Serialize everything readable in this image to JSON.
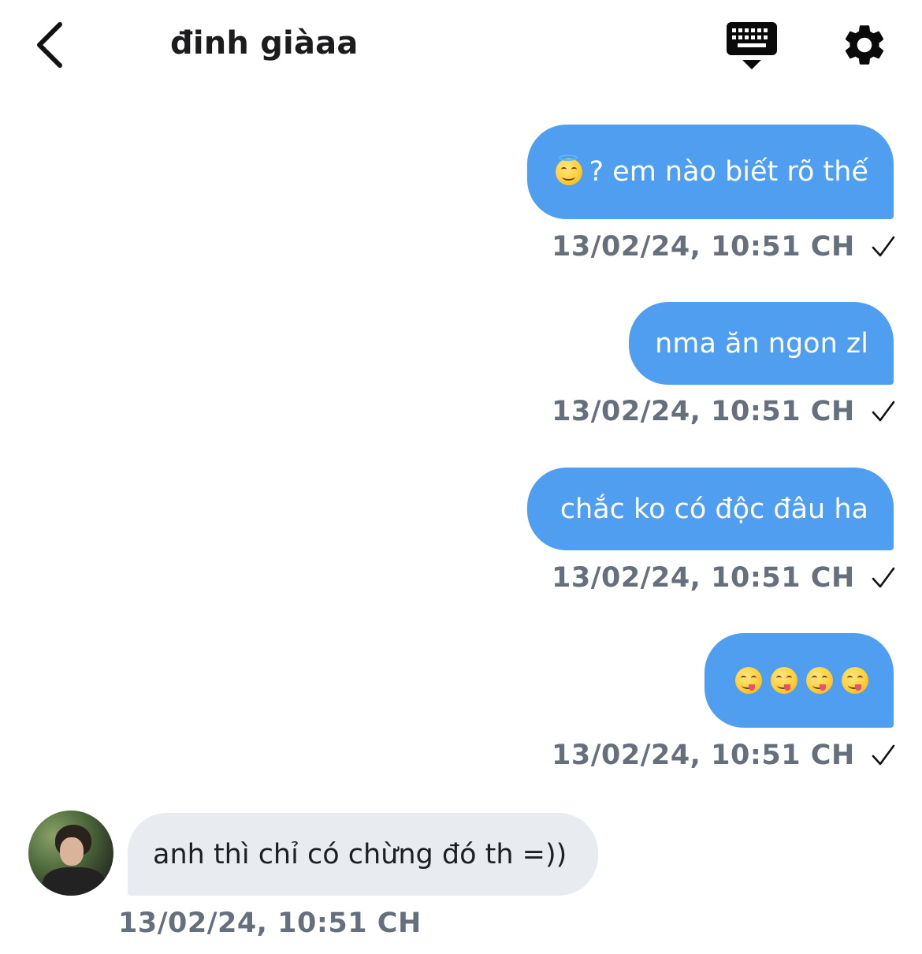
{
  "header": {
    "title": "đinh giàaa",
    "back_icon": "chevron-left-icon",
    "keyboard_icon": "keyboard-dismiss-icon",
    "settings_icon": "gear-icon"
  },
  "colors": {
    "outgoing_bubble": "#4f9ef0",
    "incoming_bubble": "#e8ebef",
    "timestamp": "#66707c"
  },
  "messages": [
    {
      "direction": "out",
      "emoji": "halo-smiling-face-emoji",
      "text": "? em nào biết rõ thế",
      "timestamp": "13/02/24, 10:51 CH",
      "status_icon": "check-icon"
    },
    {
      "direction": "out",
      "text": "nma ăn ngon zl",
      "timestamp": "13/02/24, 10:51 CH",
      "status_icon": "check-icon"
    },
    {
      "direction": "out",
      "text": "chắc ko có độc đâu ha",
      "timestamp": "13/02/24, 10:51 CH",
      "status_icon": "check-icon"
    },
    {
      "direction": "out",
      "emojis": [
        "yum-face-emoji",
        "yum-face-emoji",
        "yum-face-emoji",
        "yum-face-emoji"
      ],
      "timestamp": "13/02/24, 10:51 CH",
      "status_icon": "check-icon"
    },
    {
      "direction": "in",
      "text": "anh thì chỉ có chừng đó th =))",
      "timestamp": "13/02/24, 10:51 CH"
    }
  ]
}
